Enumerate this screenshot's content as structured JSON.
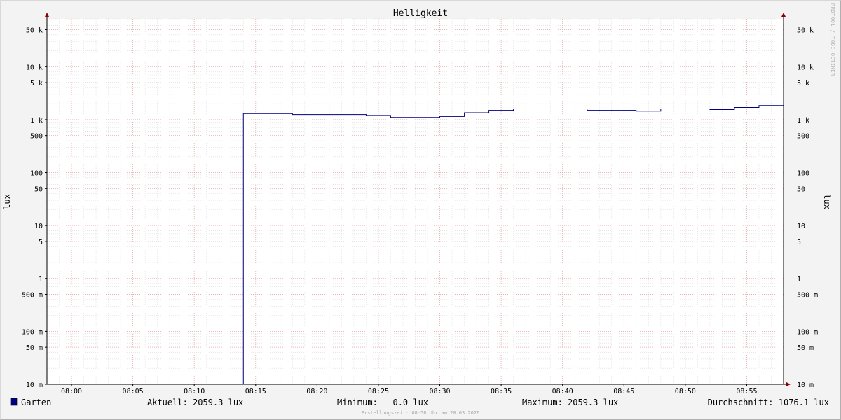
{
  "chart_data": {
    "type": "line",
    "title": "Helligkeit",
    "ylabel": "lux",
    "ylabel_right": "lux",
    "y_scale": "log",
    "ylim": [
      10,
      80000
    ],
    "xlim": [
      "07:58",
      "08:58"
    ],
    "grid": true,
    "x_ticks": [
      "08:00",
      "08:05",
      "08:10",
      "08:15",
      "08:20",
      "08:25",
      "08:30",
      "08:35",
      "08:40",
      "08:45",
      "08:50",
      "08:55"
    ],
    "y_ticks": [
      {
        "value": 50000,
        "label": "50 k"
      },
      {
        "value": 10000,
        "label": "10 k"
      },
      {
        "value": 5000,
        "label": "5 k"
      },
      {
        "value": 1000,
        "label": "1 k"
      },
      {
        "value": 500,
        "label": "500"
      },
      {
        "value": 100,
        "label": "100"
      },
      {
        "value": 50,
        "label": "50"
      },
      {
        "value": 10,
        "label": "10"
      },
      {
        "value": 5,
        "label": "5"
      },
      {
        "value": 1,
        "label": "1"
      },
      {
        "value": 0.5,
        "label": "500 m"
      },
      {
        "value": 0.1,
        "label": "100 m"
      },
      {
        "value": 0.05,
        "label": "50 m"
      },
      {
        "value": 0.01,
        "label": "10 m"
      }
    ],
    "series": [
      {
        "name": "Garten",
        "color": "#000080",
        "step": true,
        "x": [
          "07:58",
          "08:14",
          "08:18",
          "08:24",
          "08:26",
          "08:30",
          "08:32",
          "08:34",
          "08:36",
          "08:42",
          "08:46",
          "08:48",
          "08:52",
          "08:54",
          "08:56",
          "08:58"
        ],
        "y": [
          0.0,
          1300,
          1250,
          1200,
          1100,
          1150,
          1350,
          1500,
          1600,
          1500,
          1450,
          1600,
          1550,
          1700,
          1850,
          2059.3
        ]
      }
    ]
  },
  "watermark": "RRDTOOL / TOBI OETIKER",
  "legend": {
    "swatch_color": "#000080",
    "name": "Garten",
    "current": "Aktuell: 2059.3 lux",
    "minimum": "Minimum:   0.0 lux",
    "maximum": "Maximum: 2059.3 lux",
    "average": "Durchschnitt: 1076.1 lux"
  },
  "footer": "Erstellungszeit: 08:58 Uhr am 20.03.2026"
}
